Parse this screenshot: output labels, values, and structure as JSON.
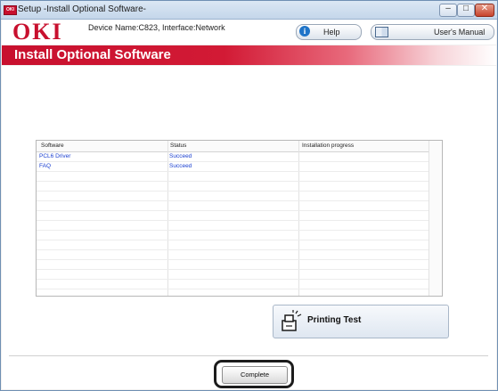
{
  "window": {
    "title": "Setup -Install Optional Software-",
    "minimize_glyph": "–",
    "maximize_glyph": "□",
    "close_glyph": "✕"
  },
  "header": {
    "logo": "OKI",
    "device_info": "Device Name:C823, Interface:Network",
    "help_label": "Help",
    "manual_label": "User's Manual"
  },
  "banner": {
    "title": "Install Optional Software"
  },
  "table": {
    "columns": [
      "Software",
      "Status",
      "Installation progress"
    ],
    "rows": [
      {
        "software": "PCL6 Driver",
        "status": "Succeed",
        "progress": ""
      },
      {
        "software": "FAQ",
        "status": "Succeed",
        "progress": ""
      }
    ]
  },
  "actions": {
    "printing_test_label": "Printing Test",
    "complete_label": "Complete"
  },
  "colors": {
    "brand_red": "#c8102e",
    "link_blue": "#1a3fd0"
  },
  "icons": {
    "app": "oki-app-icon",
    "help": "info-icon",
    "manual": "book-icon",
    "print": "printer-icon"
  }
}
